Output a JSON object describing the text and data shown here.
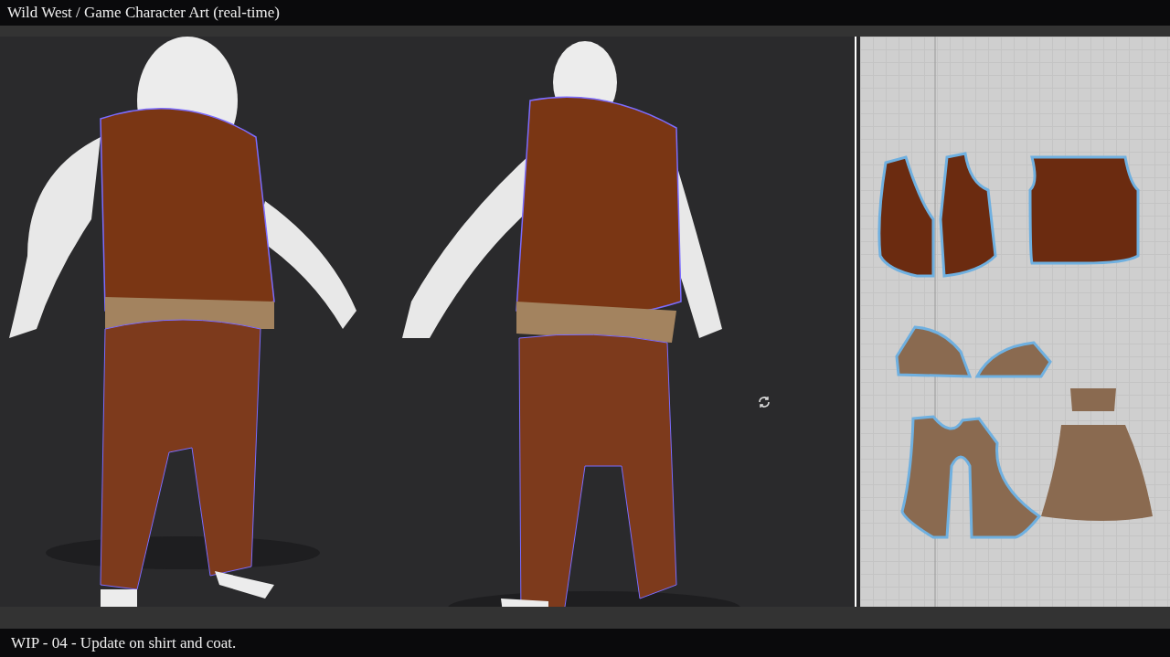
{
  "header": {
    "title": "Wild West / Game Character Art (real-time)"
  },
  "caption": {
    "text": "WIP - 04 - Update on shirt and coat."
  }
}
